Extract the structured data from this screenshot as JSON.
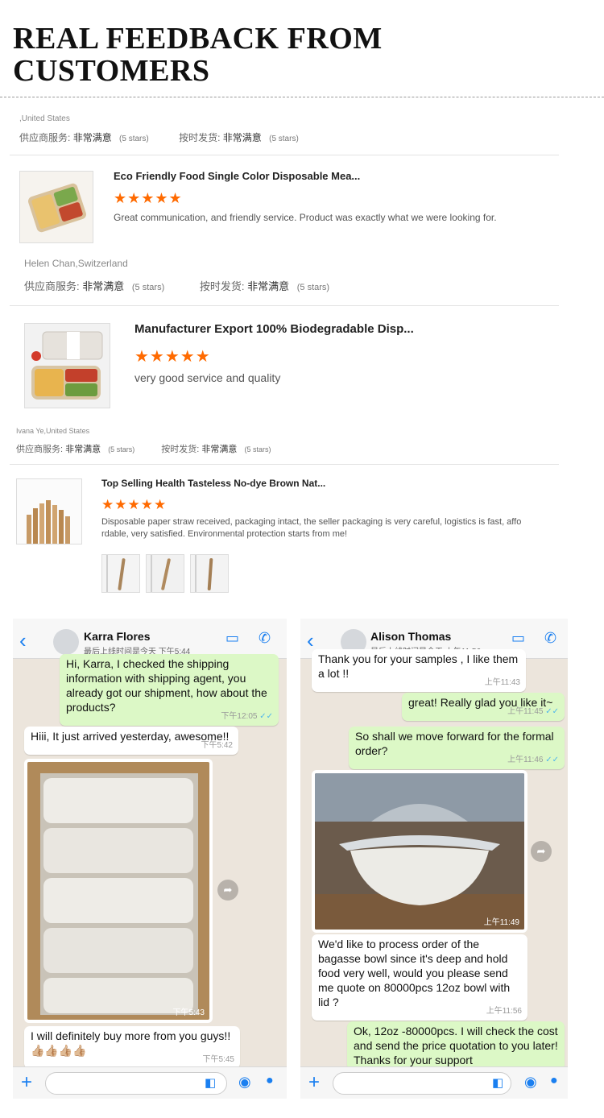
{
  "heading": {
    "line1": "REAL FEEDBACK FROM",
    "line2": "CUSTOMERS"
  },
  "reviews": [
    {
      "reviewer": ",United States",
      "ratings": [
        {
          "label": "供应商服务:",
          "value": "非常满意",
          "stars_text": "(5 stars)"
        },
        {
          "label": "按时发货:",
          "value": "非常满意",
          "stars_text": "(5 stars)"
        }
      ]
    },
    {
      "product_title": "Eco Friendly Food Single Color Disposable Mea...",
      "stars": "★★★★★",
      "star_count": 5,
      "comment": "Great communication, and friendly service. Product was exactly what we were looking for.",
      "reviewer": "Helen Chan,Switzerland",
      "ratings": [
        {
          "label": "供应商服务:",
          "value": "非常满意",
          "stars_text": "(5 stars)"
        },
        {
          "label": "按时发货:",
          "value": "非常满意",
          "stars_text": "(5 stars)"
        }
      ]
    },
    {
      "product_title": "Manufacturer Export 100% Biodegradable Disp...",
      "stars": "★★★★★",
      "star_count": 5,
      "comment": "very good service and quality",
      "reviewer": "Ivana Ye,United States",
      "ratings": [
        {
          "label": "供应商服务:",
          "value": "非常满意",
          "stars_text": "(5 stars)"
        },
        {
          "label": "按时发货:",
          "value": "非常满意",
          "stars_text": "(5 stars)"
        }
      ]
    },
    {
      "product_title": "Top Selling Health Tasteless No-dye Brown Nat...",
      "stars": "★★★★★",
      "star_count": 5,
      "comment_line1": "Disposable paper straw received, packaging intact, the seller packaging is very careful, logistics is fast, affo",
      "comment_line2": "rdable, very satisfied. Environmental protection starts from me!"
    }
  ],
  "chats": [
    {
      "contact": "Karra Flores",
      "last_seen": "最后上线时间是今天 下午5:44",
      "messages": [
        {
          "text": "Hi, Karra, I checked the shipping information with shipping agent, you already got our shipment, how about the products?",
          "time": "下午12:05",
          "tick": "✓✓"
        },
        {
          "text": "Hiii, It just arrived yesterday, awesome!!",
          "time": "下午5:42"
        },
        {
          "time": "下午5:43"
        },
        {
          "text": "I will definitely buy more from you guys!!",
          "emoji": "👍🏼👍🏼👍🏼👍🏼",
          "time": "下午5:45"
        }
      ]
    },
    {
      "contact": "Alison Thomas",
      "last_seen": "最后上线时间是今天 上午11:56",
      "messages": [
        {
          "text": "Thank you for your samples , I like them a lot !!",
          "time": "上午11:43"
        },
        {
          "text": "great! Really glad you like it~",
          "time": "上午11:45",
          "tick": "✓✓"
        },
        {
          "text": "So shall we move forward for the formal order?",
          "time": "上午11:46",
          "tick": "✓✓"
        },
        {
          "time": "上午11:49"
        },
        {
          "text": "We'd like to process order of the bagasse bowl since it's deep and hold food very well, would you please send me quote on 80000pcs 12oz bowl with lid ?",
          "time": "上午11:56"
        },
        {
          "text": "Ok, 12oz -80000pcs. I will check the cost and send the price quotation to you later! Thanks for your support"
        }
      ]
    }
  ]
}
